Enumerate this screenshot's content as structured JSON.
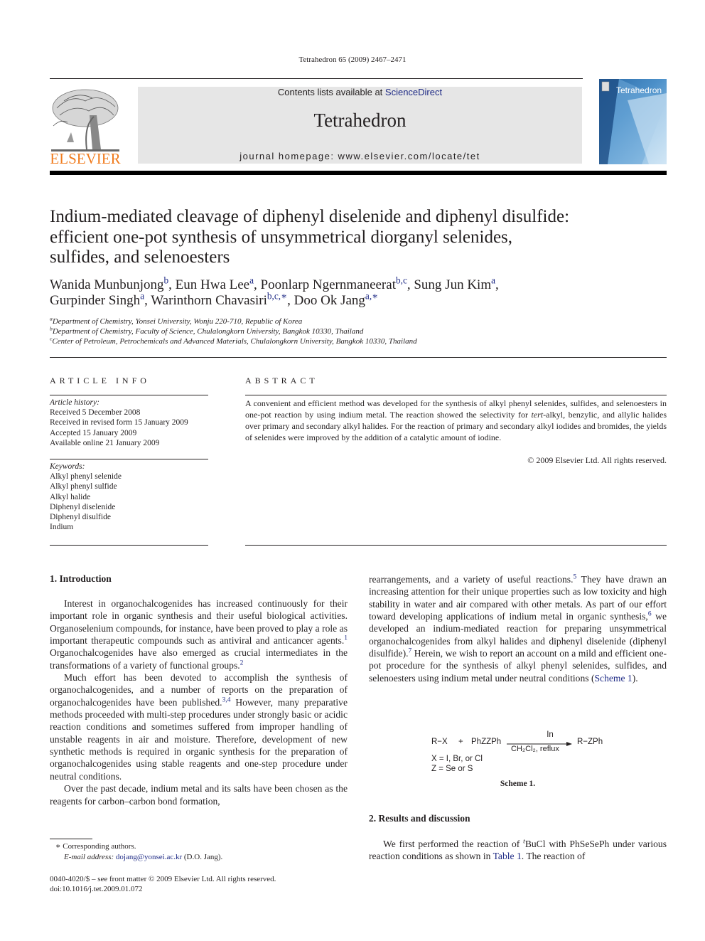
{
  "running_head": "Tetrahedron 65 (2009) 2467–2471",
  "publisher_logo_text": "ELSEVIER",
  "masthead": {
    "contents_prefix": "Contents lists available at ",
    "contents_link": "ScienceDirect",
    "journal_title": "Tetrahedron",
    "homepage": "journal homepage: www.elsevier.com/locate/tet"
  },
  "cover": {
    "title": "Tetrahedron"
  },
  "article": {
    "title_lines": [
      "Indium-mediated cleavage of diphenyl diselenide and diphenyl disulfide:",
      "efficient one-pot synthesis of unsymmetrical diorganyl selenides,",
      "sulfides, and selenoesters"
    ],
    "authors": [
      {
        "name": "Wanida Munbunjong",
        "aff": "b",
        "sep": ", "
      },
      {
        "name": "Eun Hwa Lee",
        "aff": "a",
        "sep": ", "
      },
      {
        "name": "Poonlarp Ngernmaneerat",
        "aff": "b,c",
        "sep": ", "
      },
      {
        "name": "Sung Jun Kim",
        "aff": "a",
        "sep": ","
      },
      {
        "name": "Gurpinder Singh",
        "aff": "a",
        "sep": ", "
      },
      {
        "name": "Warinthorn Chavasiri",
        "aff": "b,c,∗",
        "sep": ", "
      },
      {
        "name": "Doo Ok Jang",
        "aff": "a,∗",
        "sep": ""
      }
    ],
    "affiliations": [
      {
        "key": "a",
        "text": "Department of Chemistry, Yonsei University, Wonju 220-710, Republic of Korea"
      },
      {
        "key": "b",
        "text": "Department of Chemistry, Faculty of Science, Chulalongkorn University, Bangkok 10330, Thailand"
      },
      {
        "key": "c",
        "text": "Center of Petroleum, Petrochemicals and Advanced Materials, Chulalongkorn University, Bangkok 10330, Thailand"
      }
    ]
  },
  "article_info": {
    "heading": "ARTICLE INFO",
    "history_label": "Article history:",
    "history": [
      "Received 5 December 2008",
      "Received in revised form 15 January 2009",
      "Accepted 15 January 2009",
      "Available online 21 January 2009"
    ],
    "keywords_label": "Keywords:",
    "keywords": [
      "Alkyl phenyl selenide",
      "Alkyl phenyl sulfide",
      "Alkyl halide",
      "Diphenyl diselenide",
      "Diphenyl disulfide",
      "Indium"
    ]
  },
  "abstract": {
    "heading": "ABSTRACT",
    "text_part1": "A convenient and efficient method was developed for the synthesis of alkyl phenyl selenides, sulfides, and selenoesters in one-pot reaction by using indium metal. The reaction showed the selectivity for ",
    "text_italic": "tert",
    "text_part2": "-alkyl, benzylic, and allylic halides over primary and secondary alkyl halides. For the reaction of primary and secondary alkyl iodides and bromides, the yields of selenides were improved by the addition of a catalytic amount of iodine.",
    "copyright": "© 2009 Elsevier Ltd. All rights reserved."
  },
  "section1": {
    "heading": "1.  Introduction",
    "p1a": "Interest in organochalcogenides has increased continuously for their important role in organic synthesis and their useful biological activities. Organoselenium compounds, for instance, have been proved to play a role as important therapeutic compounds such as antiviral and anticancer agents.",
    "ref1": "1",
    "p1b": " Organochalcogenides have also emerged as crucial intermediates in the transformations of a variety of functional groups.",
    "ref2": "2",
    "p2a": "Much effort has been devoted to accomplish the synthesis of organochalcogenides, and a number of reports on the preparation of organochalcogenides have been published.",
    "ref34": "3,4",
    "p2b": " However, many preparative methods proceeded with multi-step procedures under strongly basic or acidic reaction conditions and sometimes suffered from improper handling of unstable reagents in air and moisture. Therefore, development of new synthetic methods is required in organic synthesis for the preparation of organochalcogenides using stable reagents and one-step procedure under neutral conditions.",
    "p3": "Over the past decade, indium metal and its salts have been chosen as the reagents for carbon–carbon bond formation,",
    "r1a": "rearrangements, and a variety of useful reactions.",
    "ref5": "5",
    "r1b": " They have drawn an increasing attention for their unique properties such as low toxicity and high stability in water and air compared with other metals. As part of our effort toward developing applications of indium metal in organic synthesis,",
    "ref6": "6",
    "r1c": " we developed an indium-mediated reaction for preparing unsymmetrical organochalcogenides from alkyl halides and diphenyl diselenide (diphenyl disulfide).",
    "ref7": "7",
    "r1d": " Herein, we wish to report an account on a mild and efficient one-pot procedure for the synthesis of alkyl phenyl selenides, sulfides, and selenoesters using indium metal under neutral conditions (",
    "scheme_link": "Scheme 1",
    "r1e": ")."
  },
  "scheme1": {
    "reactant1": "R−X",
    "plus": "+",
    "reactant2": "PhZZPh",
    "reagent_above": "In",
    "conditions_below": "CH₂Cl₂, reflux",
    "product": "R−ZPh",
    "note_x": "X = I, Br, or Cl",
    "note_z": "Z = Se or S",
    "caption": "Scheme 1."
  },
  "section2": {
    "heading": "2.  Results and discussion",
    "p1a": "We first performed the reaction of ",
    "sup_t": "t",
    "p1b": "BuCl with PhSeSePh under various reaction conditions as shown in ",
    "table_link": "Table 1",
    "p1c": ". The reaction of"
  },
  "footnotes": {
    "corresponding": "∗  Corresponding authors.",
    "email_label": "E-mail address: ",
    "email": "dojang@yonsei.ac.kr",
    "email_suffix": " (D.O. Jang)."
  },
  "front_matter": {
    "issn_line": "0040-4020/$ – see front matter © 2009 Elsevier Ltd. All rights reserved.",
    "doi": "doi:10.1016/j.tet.2009.01.072"
  },
  "colors": {
    "link": "#1e2a85",
    "elsevier_orange": "#f07b1d",
    "masthead_bg": "#e6e6e6"
  }
}
